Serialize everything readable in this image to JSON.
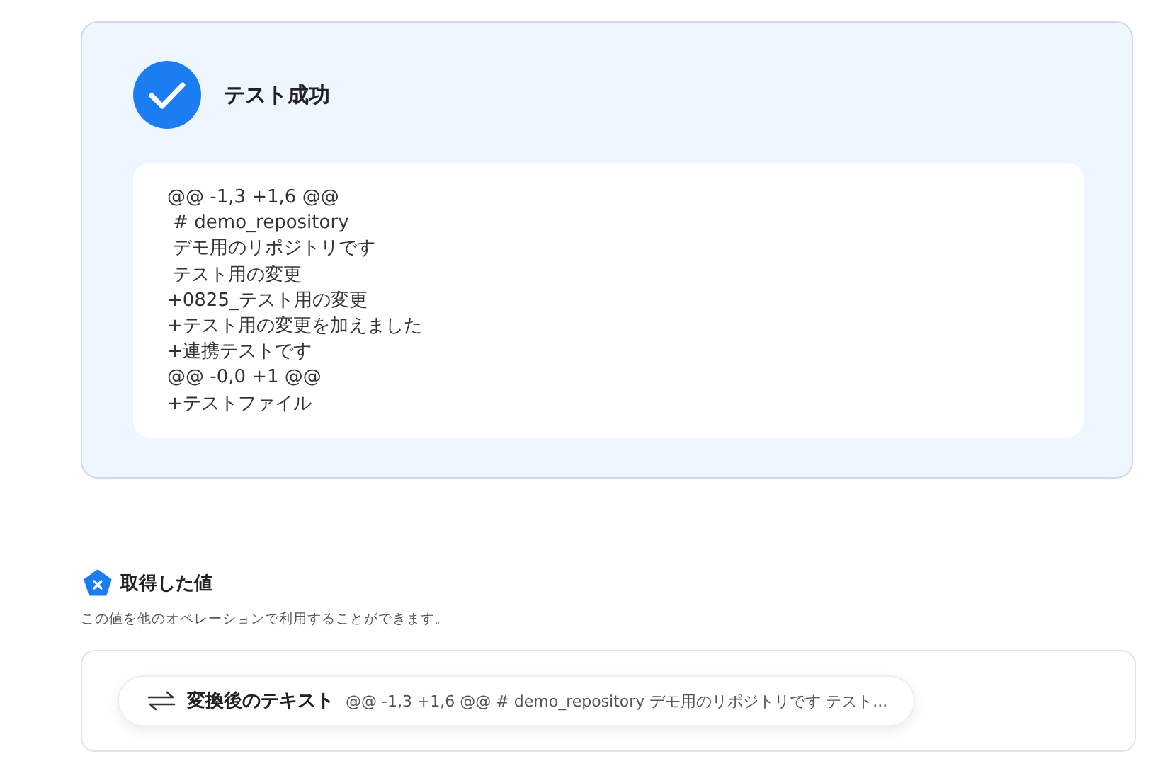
{
  "result": {
    "title": "テスト成功",
    "lines": [
      "@@ -1,3 +1,6 @@",
      " # demo_repository",
      " デモ用のリポジトリです",
      " テスト用の変更",
      "+0825_テスト用の変更",
      "+テスト用の変更を加えました",
      "+連携テストです",
      "@@ -0,0 +1 @@",
      "+テストファイル"
    ]
  },
  "output": {
    "title": "取得した値",
    "description": "この値を他のオペレーションで利用することができます。",
    "items": [
      {
        "label": "変換後のテキスト",
        "value": "@@ -1,3 +1,6 @@ # demo_repository デモ用のリポジトリです テスト..."
      }
    ]
  }
}
